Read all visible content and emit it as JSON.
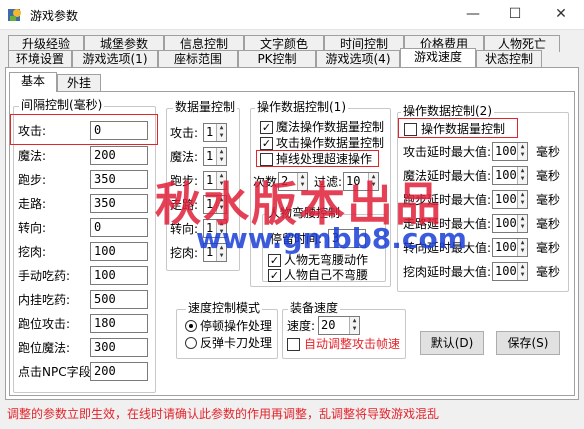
{
  "window": {
    "title": "游戏参数",
    "minimize": "—",
    "maximize": "☐",
    "close": "✕"
  },
  "tabs_row1": [
    "升级经验",
    "城堡参数",
    "信息控制",
    "文字颜色",
    "时间控制",
    "价格费用",
    "人物死亡"
  ],
  "tabs_row2": [
    "环境设置",
    "游戏选项(1)",
    "座标范围",
    "PK控制",
    "游戏选项(4)",
    "游戏速度",
    "状态控制"
  ],
  "subtabs": [
    "基本",
    "外挂"
  ],
  "interval_group": {
    "title": "间隔控制(毫秒)",
    "rows": [
      {
        "label": "攻击:",
        "value": "0"
      },
      {
        "label": "魔法:",
        "value": "200"
      },
      {
        "label": "跑步:",
        "value": "350"
      },
      {
        "label": "走路:",
        "value": "350"
      },
      {
        "label": "转向:",
        "value": "0"
      },
      {
        "label": "挖肉:",
        "value": "100"
      },
      {
        "label": "手动吃药:",
        "value": "100"
      },
      {
        "label": "内挂吃药:",
        "value": "500"
      },
      {
        "label": "跑位攻击:",
        "value": "180"
      },
      {
        "label": "跑位魔法:",
        "value": "300"
      },
      {
        "label": "点击NPC字段:",
        "value": "200"
      }
    ]
  },
  "count_group": {
    "title": "数据量控制",
    "rows": [
      {
        "label": "攻击:",
        "value": "1"
      },
      {
        "label": "魔法:",
        "value": "1"
      },
      {
        "label": "跑步:",
        "value": "1"
      },
      {
        "label": "走路:",
        "value": "1"
      },
      {
        "label": "转向:",
        "value": "1"
      },
      {
        "label": "挖肉:",
        "value": "1"
      }
    ]
  },
  "op1_group": {
    "title": "操作数据控制(1)",
    "magic_ctrl": "魔法操作数据量控制",
    "attack_ctrl": "攻击操作数据量控制",
    "dropline": "掉线处理超速操作",
    "count_label": "次数:",
    "count_value": "2",
    "filter_label": "过滤:",
    "filter_value": "10"
  },
  "bend_group": {
    "title": "人物弯腰控制",
    "stay_label": "停留时间:",
    "stay_value": "3",
    "no_bend_action": "人物无弯腰动作",
    "no_bend_self": "人物自己不弯腰"
  },
  "op2_group": {
    "title": "操作数据控制(2)",
    "data_ctrl": "操作数据量控制",
    "unit": "毫秒",
    "rows": [
      {
        "label": "攻击延时最大值:",
        "value": "100"
      },
      {
        "label": "魔法延时最大值:",
        "value": "100"
      },
      {
        "label": "跑步延时最大值:",
        "value": "100"
      },
      {
        "label": "走路延时最大值:",
        "value": "100"
      },
      {
        "label": "转向延时最大值:",
        "value": "100"
      },
      {
        "label": "挖肉延时最大值:",
        "value": "100"
      }
    ]
  },
  "speed_mode_group": {
    "title": "速度控制模式",
    "opt1": "停顿操作处理",
    "opt2": "反弹卡刀处理"
  },
  "equip_speed_group": {
    "title": "装备速度",
    "speed_label": "速度:",
    "speed_value": "20",
    "auto_adjust": "自动调整攻击帧速"
  },
  "buttons": {
    "default": "默认(D)",
    "save": "保存(S)"
  },
  "warning": "调整的参数立即生效，在线时请确认此参数的作用再调整，乱调整将导致游戏混乱",
  "watermark": {
    "line1": "秋水版本出品",
    "line2": "www.gmbb8.com"
  },
  "colors": {
    "accent_red": "#e3242b",
    "watermark_red": "#e0203a",
    "watermark_blue": "#1a3fd6"
  }
}
